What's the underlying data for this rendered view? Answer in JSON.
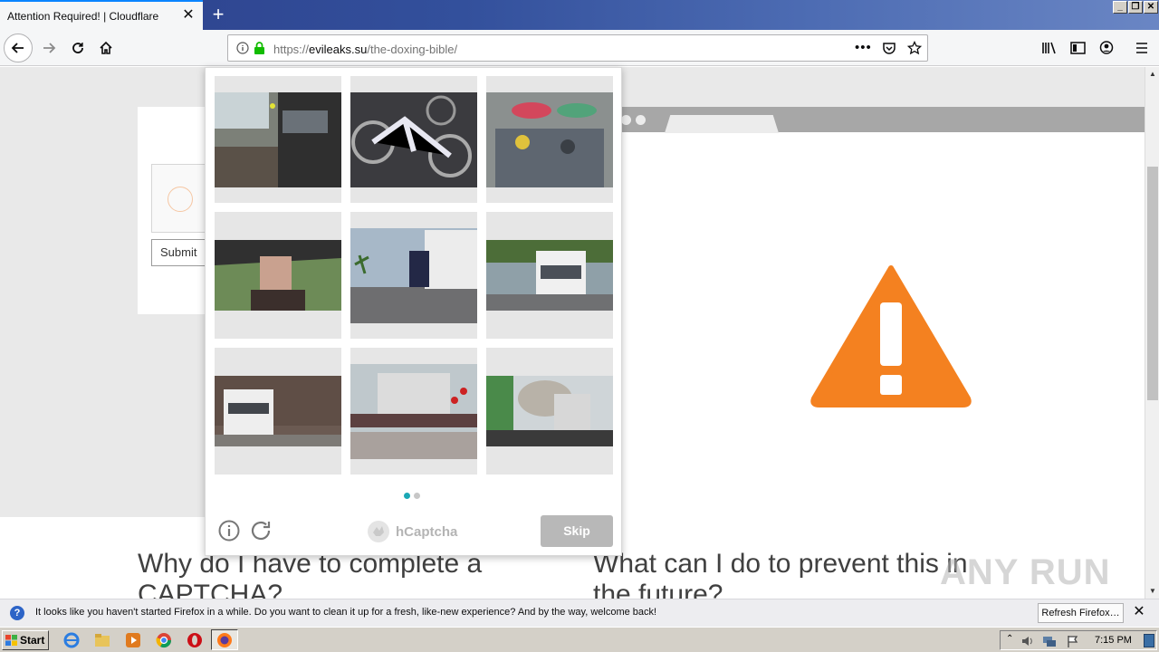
{
  "tab": {
    "title": "Attention Required! | Cloudflare"
  },
  "url": {
    "prefix": "https://",
    "domain": "evileaks.su",
    "path": "/the-doxing-bible/"
  },
  "cloudflare": {
    "submit_label": "Submit"
  },
  "faq": {
    "left_title_line1": "Why do I have to complete a",
    "left_title_line2": "CAPTCHA?",
    "right_title_line1": "What can I do to prevent this in",
    "right_title_line2": "the future?"
  },
  "hcaptcha": {
    "brand": "hCaptcha",
    "skip_label": "Skip",
    "tiles": [
      {
        "content": "train station platform"
      },
      {
        "content": "bicycles"
      },
      {
        "content": "crowd with umbrellas"
      },
      {
        "content": "person with umbrella"
      },
      {
        "content": "truck on road"
      },
      {
        "content": "white truck"
      },
      {
        "content": "truck near forest"
      },
      {
        "content": "freight train containers"
      },
      {
        "content": "cement mixer truck"
      }
    ],
    "pages": 2,
    "current_page": 1
  },
  "notification": {
    "text": "It looks like you haven't started Firefox in a while. Do you want to clean it up for a fresh, like-new experience? And by the way, welcome back!",
    "button_label": "Refresh Firefox…"
  },
  "taskbar": {
    "start_label": "Start",
    "clock": "7:15 PM"
  },
  "watermark": "ANY RUN",
  "colors": {
    "warning": "#f48120",
    "hcaptcha_accent": "#1ba8b5",
    "tab_accent": "#0a84ff"
  }
}
